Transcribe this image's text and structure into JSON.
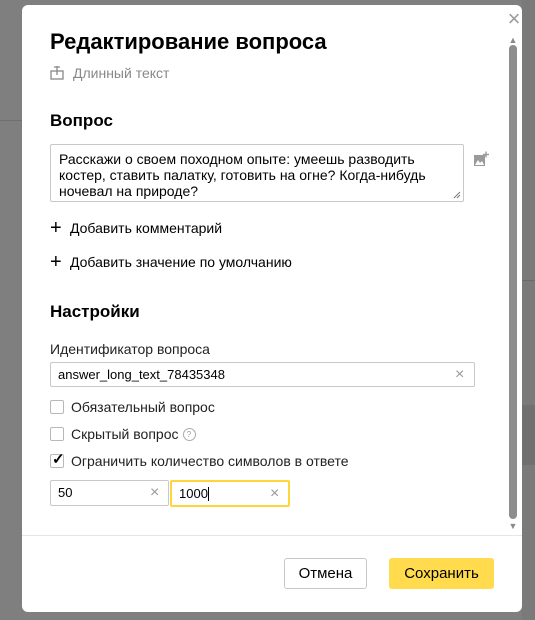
{
  "dialog": {
    "title": "Редактирование вопроса",
    "subtitle": "Длинный текст",
    "close_icon": "close-icon"
  },
  "question_section": {
    "heading": "Вопрос",
    "question_text": "Расскажи о своем походном опыте: умеешь разводить костер, ставить палатку, готовить на огне? Когда-нибудь ночевал на природе?",
    "add_comment": "Добавить комментарий",
    "add_default_value": "Добавить значение по умолчанию"
  },
  "settings_section": {
    "heading": "Настройки",
    "id_label": "Идентификатор вопроса",
    "id_value": "answer_long_text_78435348",
    "required_label": "Обязательный вопрос",
    "required_checked": false,
    "hidden_label": "Скрытый вопрос",
    "hidden_checked": false,
    "limit_label": "Ограничить количество символов в ответе",
    "limit_checked": true,
    "min_value": "50",
    "max_value": "1000"
  },
  "footer": {
    "cancel_label": "Отмена",
    "save_label": "Сохранить"
  },
  "colors": {
    "accent": "#ffdb4d",
    "focus_border": "#ffd63a",
    "overlay": "#7f7f7f"
  }
}
